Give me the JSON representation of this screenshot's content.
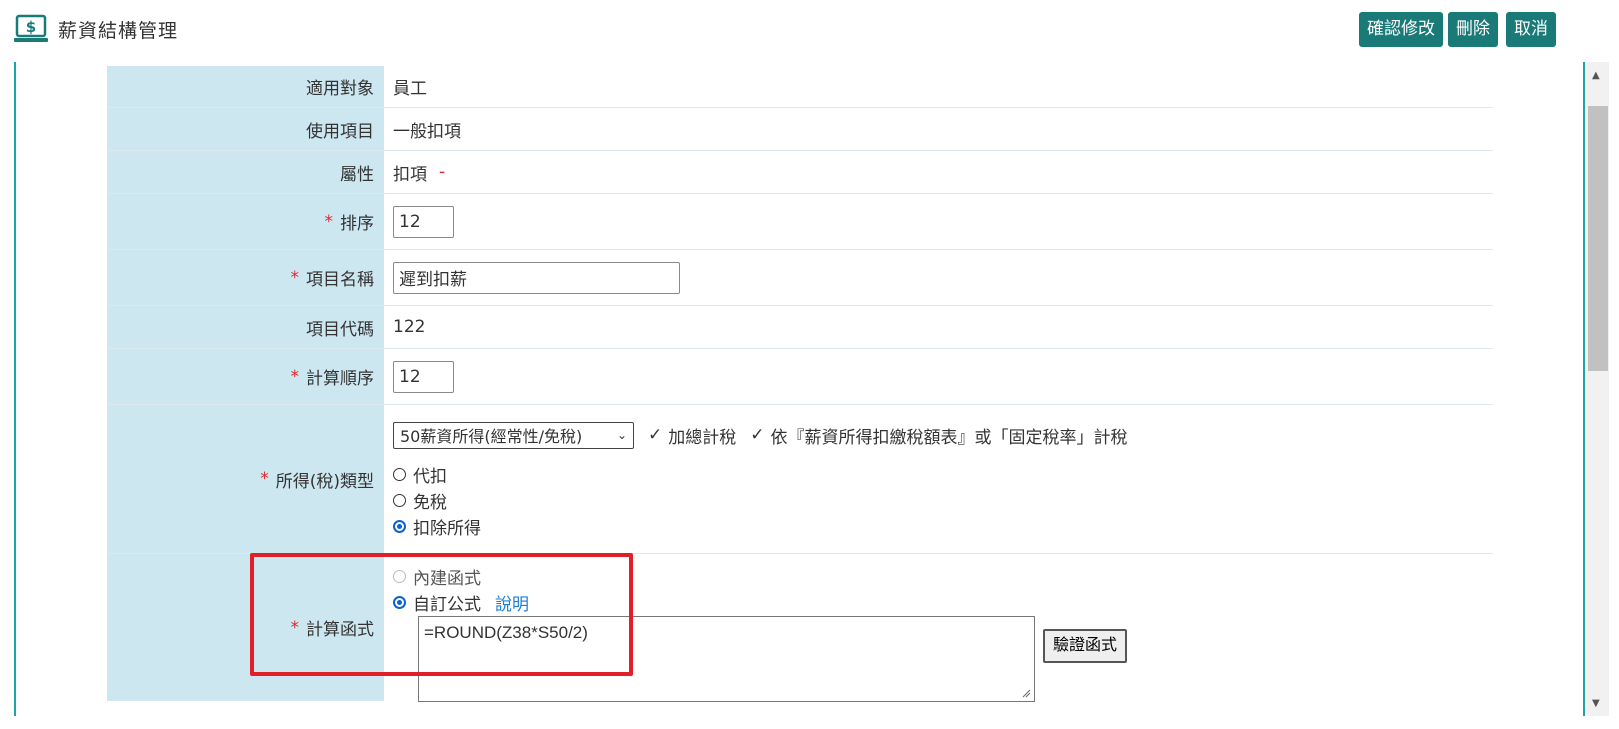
{
  "header": {
    "title": "薪資結構管理",
    "buttons": {
      "confirm": "確認修改",
      "delete": "刪除",
      "cancel": "取消"
    }
  },
  "form": {
    "target": {
      "label": "適用對象",
      "value": "員工"
    },
    "usage": {
      "label": "使用項目",
      "value": "一般扣項"
    },
    "attribute": {
      "label": "屬性",
      "value": "扣項",
      "sign": "-"
    },
    "sort": {
      "label": "排序",
      "value": "12",
      "required": "*"
    },
    "item_name": {
      "label": "項目名稱",
      "value": "遲到扣薪",
      "required": "*"
    },
    "item_code": {
      "label": "項目代碼",
      "value": "122"
    },
    "calc_order": {
      "label": "計算順序",
      "value": "12",
      "required": "*"
    },
    "income_type": {
      "label": "所得(稅)類型",
      "required": "*",
      "select_value": "50薪資所得(經常性/免稅)",
      "check1": "加總計稅",
      "check2": "依『薪資所得扣繳稅額表』或「固定稅率」計稅",
      "options": [
        "代扣",
        "免稅",
        "扣除所得"
      ],
      "selected": "扣除所得"
    },
    "calc_func": {
      "label": "計算函式",
      "required": "*",
      "options": [
        "內建函式",
        "自訂公式"
      ],
      "selected": "自訂公式",
      "help_link": "說明",
      "formula": "=ROUND(Z38*S50/2)",
      "verify_button": "驗證函式"
    }
  },
  "colors": {
    "accent": "#1a7a78",
    "label_bg": "#cde7f1",
    "required": "#e5252a",
    "highlight": "#e02028",
    "link": "#1b7fd6"
  }
}
